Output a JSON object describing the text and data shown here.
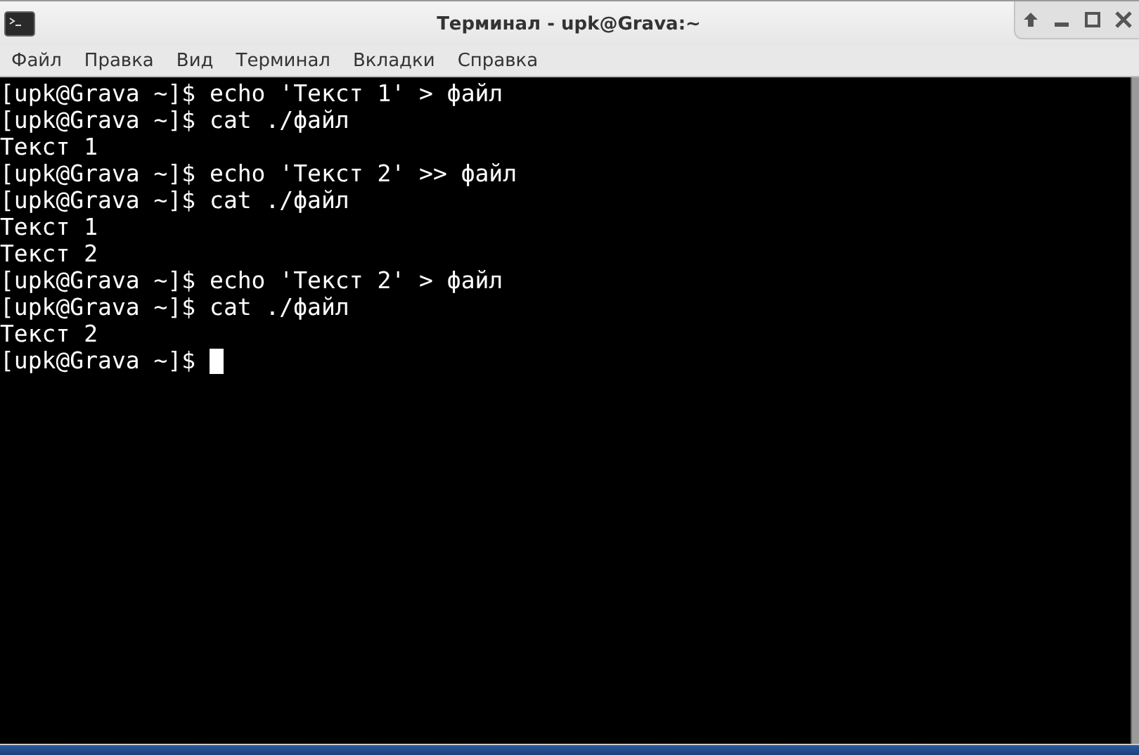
{
  "window": {
    "title": "Терминал - upk@Grava:~"
  },
  "menu": [
    "Файл",
    "Правка",
    "Вид",
    "Терминал",
    "Вкладки",
    "Справка"
  ],
  "terminal": {
    "lines": [
      {
        "kind": "prompt",
        "prompt": "[upk@Grava ~]$",
        "command": "echo 'Текст 1' > файл"
      },
      {
        "kind": "prompt",
        "prompt": "[upk@Grava ~]$",
        "command": "cat ./файл"
      },
      {
        "kind": "output",
        "text": "Текст 1"
      },
      {
        "kind": "prompt",
        "prompt": "[upk@Grava ~]$",
        "command": "echo 'Текст 2' >> файл"
      },
      {
        "kind": "prompt",
        "prompt": "[upk@Grava ~]$",
        "command": "cat ./файл"
      },
      {
        "kind": "output",
        "text": "Текст 1"
      },
      {
        "kind": "output",
        "text": "Текст 2"
      },
      {
        "kind": "prompt",
        "prompt": "[upk@Grava ~]$",
        "command": "echo 'Текст 2' > файл"
      },
      {
        "kind": "prompt",
        "prompt": "[upk@Grava ~]$",
        "command": "cat ./файл"
      },
      {
        "kind": "output",
        "text": "Текст 2"
      },
      {
        "kind": "input",
        "prompt": "[upk@Grava ~]$"
      }
    ]
  }
}
